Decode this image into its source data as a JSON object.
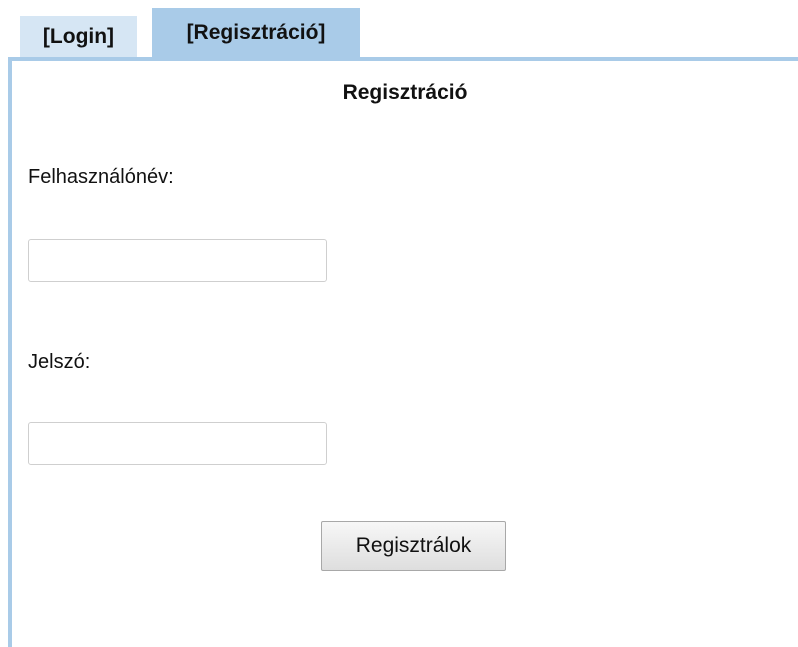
{
  "tabs": {
    "login_label": "[Login]",
    "register_label": "[Regisztráció]",
    "active": "register"
  },
  "form": {
    "title": "Regisztráció",
    "username_label": "Felhasználónév:",
    "username_value": "",
    "password_label": "Jelszó:",
    "password_value": "",
    "submit_label": "Regisztrálok"
  },
  "colors": {
    "active_tab": "#a9cbe8",
    "inactive_tab": "#d6e6f4",
    "panel_border": "#a9cbe8"
  }
}
